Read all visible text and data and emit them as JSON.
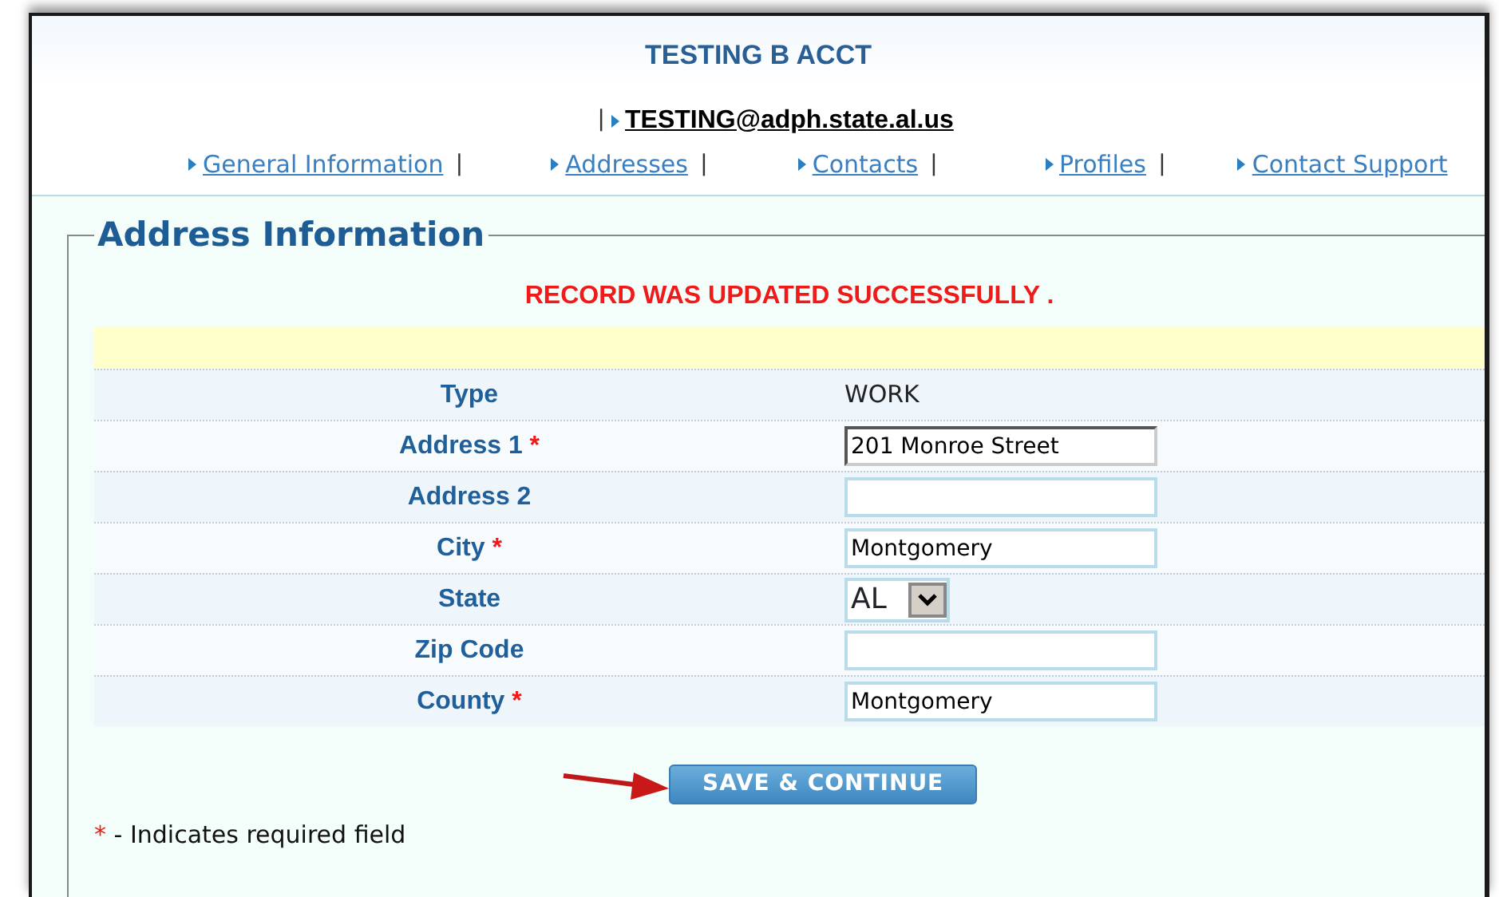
{
  "header": {
    "title": "TESTING B ACCT",
    "account_separator": "|",
    "email": "TESTING@adph.state.al.us"
  },
  "nav": [
    {
      "label": "General Information",
      "separator": "|"
    },
    {
      "label": "Addresses",
      "separator": "|"
    },
    {
      "label": "Contacts",
      "separator": "|"
    },
    {
      "label": "Profiles",
      "separator": "|"
    },
    {
      "label": "Contact Support"
    }
  ],
  "section": {
    "legend": "Address Information",
    "message": "RECORD WAS UPDATED SUCCESSFULLY ."
  },
  "fields": [
    {
      "label": "Type",
      "required": false,
      "kind": "text",
      "value": "WORK"
    },
    {
      "label": "Address 1",
      "required": true,
      "kind": "input",
      "value": "201 Monroe Street",
      "focused": true
    },
    {
      "label": "Address 2",
      "required": false,
      "kind": "input",
      "focused": false
    },
    {
      "label": "City",
      "required": true,
      "kind": "input",
      "value": "Montgomery",
      "focused": false
    },
    {
      "label": "State",
      "required": false,
      "kind": "select",
      "value": "AL"
    },
    {
      "label": "Zip Code",
      "required": false,
      "kind": "input",
      "focused": false
    },
    {
      "label": "County",
      "required": true,
      "kind": "input",
      "value": "Montgomery",
      "focused": false
    }
  ],
  "required_mark": "*",
  "save_button": "SAVE & CONTINUE",
  "footnote": {
    "mark": "*",
    "text": "- Indicates required field"
  }
}
